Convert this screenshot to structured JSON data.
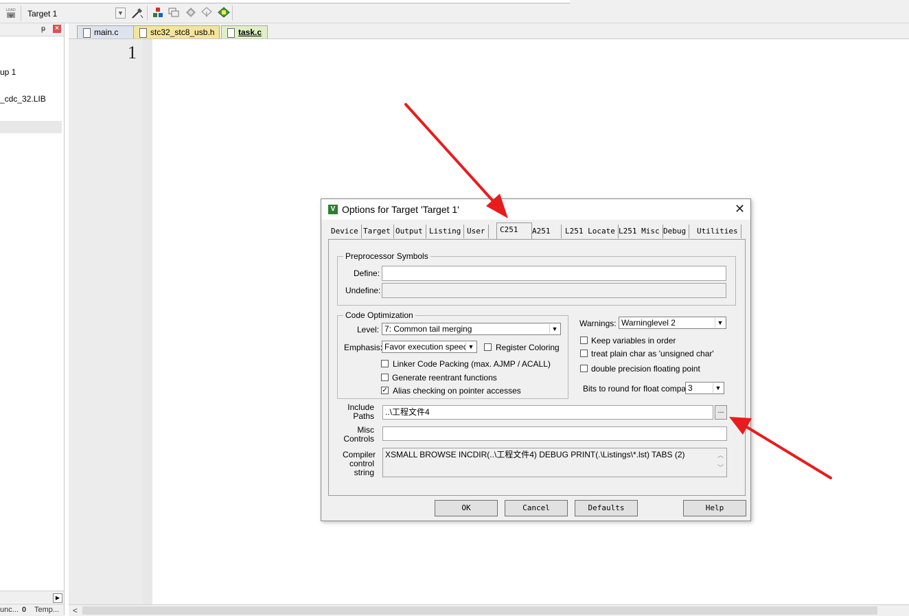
{
  "toolbar": {
    "target_select": "Target 1",
    "load_label": "LOAD"
  },
  "left_panel": {
    "tree_items": [
      "up 1",
      "_cdc_32.LIB"
    ],
    "bottom_tabs": [
      "unc...",
      "Temp..."
    ]
  },
  "editor": {
    "tabs": [
      "main.c",
      "stc32_stc8_usb.h",
      "task.c"
    ],
    "active_tab": "task.c",
    "line_number": "1"
  },
  "dialog": {
    "title": "Options for Target 'Target 1'",
    "close_glyph": "✕",
    "tabs": [
      "Device",
      "Target",
      "Output",
      "Listing",
      "User",
      "C251",
      "A251",
      "L251 Locate",
      "L251 Misc",
      "Debug",
      "Utilities"
    ],
    "active_tab": "C251",
    "preprocessor": {
      "group_title": "Preprocessor Symbols",
      "define_label": "Define:",
      "define_value": "",
      "undefine_label": "Undefine:",
      "undefine_value": ""
    },
    "code_optimization": {
      "group_title": "Code Optimization",
      "level_label": "Level:",
      "level_value": "7: Common tail merging",
      "emphasis_label": "Emphasis:",
      "emphasis_value": "Favor execution speed",
      "register_coloring_label": "Register Coloring",
      "register_coloring_checked": false,
      "linker_code_packing_label": "Linker Code Packing (max. AJMP / ACALL)",
      "linker_code_packing_checked": false,
      "reentrant_label": "Generate reentrant functions",
      "reentrant_checked": false,
      "alias_label": "Alias checking on pointer accesses",
      "alias_checked": true
    },
    "warnings": {
      "label": "Warnings:",
      "value": "Warninglevel 2",
      "keep_vars_label": "Keep variables in order",
      "keep_vars_checked": false,
      "plain_char_label": "treat plain char as 'unsigned char'",
      "plain_char_checked": false,
      "double_precision_label": "double precision floating point",
      "double_precision_checked": false,
      "bits_round_label": "Bits to round for float compare:",
      "bits_round_value": "3"
    },
    "include_paths": {
      "label_line1": "Include",
      "label_line2": "Paths",
      "value": "..\\工程文件4",
      "browse_label": "..."
    },
    "misc_controls": {
      "label_line1": "Misc",
      "label_line2": "Controls",
      "value": ""
    },
    "compiler_control": {
      "label_line1": "Compiler",
      "label_line2": "control",
      "label_line3": "string",
      "value": "XSMALL BROWSE INCDIR(..\\工程文件4) DEBUG PRINT(.\\Listings\\*.lst) TABS (2)"
    },
    "buttons": {
      "ok": "OK",
      "cancel": "Cancel",
      "defaults": "Defaults",
      "help": "Help"
    }
  },
  "colors": {
    "annotation_arrow": "#e81c1c",
    "tab_main_bg": "#dde4ee",
    "tab_usb_bg": "#f5e59a",
    "tab_task_bg": "#dff0c6"
  }
}
